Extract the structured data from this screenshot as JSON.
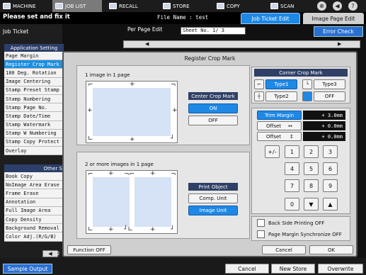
{
  "tabs": [
    {
      "label": "MACHINE",
      "icon": "machine-icon"
    },
    {
      "label": "JOB LIST",
      "icon": "job-list-icon"
    },
    {
      "label": "RECALL",
      "icon": "recall-icon"
    },
    {
      "label": "STORE",
      "icon": "store-icon"
    },
    {
      "label": "COPY",
      "icon": "copy-icon"
    },
    {
      "label": "SCAN",
      "icon": "scan-icon"
    }
  ],
  "status_icons": [
    "network-icon",
    "volume-icon",
    "help-icon"
  ],
  "header": {
    "message": "Please set and fix it",
    "file_name": "File Name : test"
  },
  "edit_tabs": {
    "ticket": "Job Ticket Edit",
    "image_page": "Image Page Edit"
  },
  "left": {
    "heading": "Job Ticket",
    "app_setting_header": "Application Setting",
    "app_items": [
      "Page Margin",
      "Register Crop Mark",
      "180 Deg. Rotation",
      "Image Centering",
      "Stamp Preset Stamp",
      "Stamp      Numbering",
      "Stamp       Page No.",
      "Stamp      Date/Time",
      "Stamp       Watermark",
      "Stamp  W Numbering",
      "Stamp Copy Protect",
      "Overlay"
    ],
    "selected_index": 1,
    "other_header": "Other S",
    "other_items": [
      "Book Copy",
      "NoImage Area Erase",
      "Frame Erase",
      "Annotation",
      "Full Image Area",
      "Copy Density",
      "Background Removal",
      "Color Adj.(R/G/B)"
    ],
    "page_indicator": "2"
  },
  "top_right": {
    "per_page": "Per Page Edit",
    "sheet": "Sheet No.        1/     3",
    "error_button": "Error Check"
  },
  "dialog": {
    "title": "Register Crop Mark",
    "one_image_label": "1 image in 1 page",
    "center_crop_header": "Center Crop Mark",
    "on_label": "ON",
    "off_label": "OFF",
    "two_image_label": "2 or more images in 1 page",
    "print_object_header": "Print Object",
    "comp_unit": "Comp. Unit",
    "image_unit": "Image Unit",
    "corner_header": "Corner Crop Mark",
    "type1": "Type1",
    "type2": "Type2",
    "type3": "Type3",
    "corner_off": "OFF",
    "trim_margin": "Trim Margin",
    "trim_value": "+ 3.0mm",
    "offset_h": "Offset",
    "offset_h_value": "+ 0.0mm",
    "offset_v": "Offset",
    "offset_v_value": "+ 0.0mm",
    "plus_minus": "+/-",
    "keys": [
      "1",
      "2",
      "3",
      "4",
      "5",
      "6",
      "7",
      "8",
      "9",
      "0"
    ],
    "back_side": "Back Side Printing OFF",
    "page_margin_sync": "Page Margin Synchronize OFF",
    "function_off": "Function OFF",
    "cancel": "Cancel",
    "ok": "OK"
  },
  "bottom": {
    "sample": "Sample Output",
    "cancel": "Cancel",
    "new_store": "New Store",
    "overwrite": "Overwrite"
  }
}
